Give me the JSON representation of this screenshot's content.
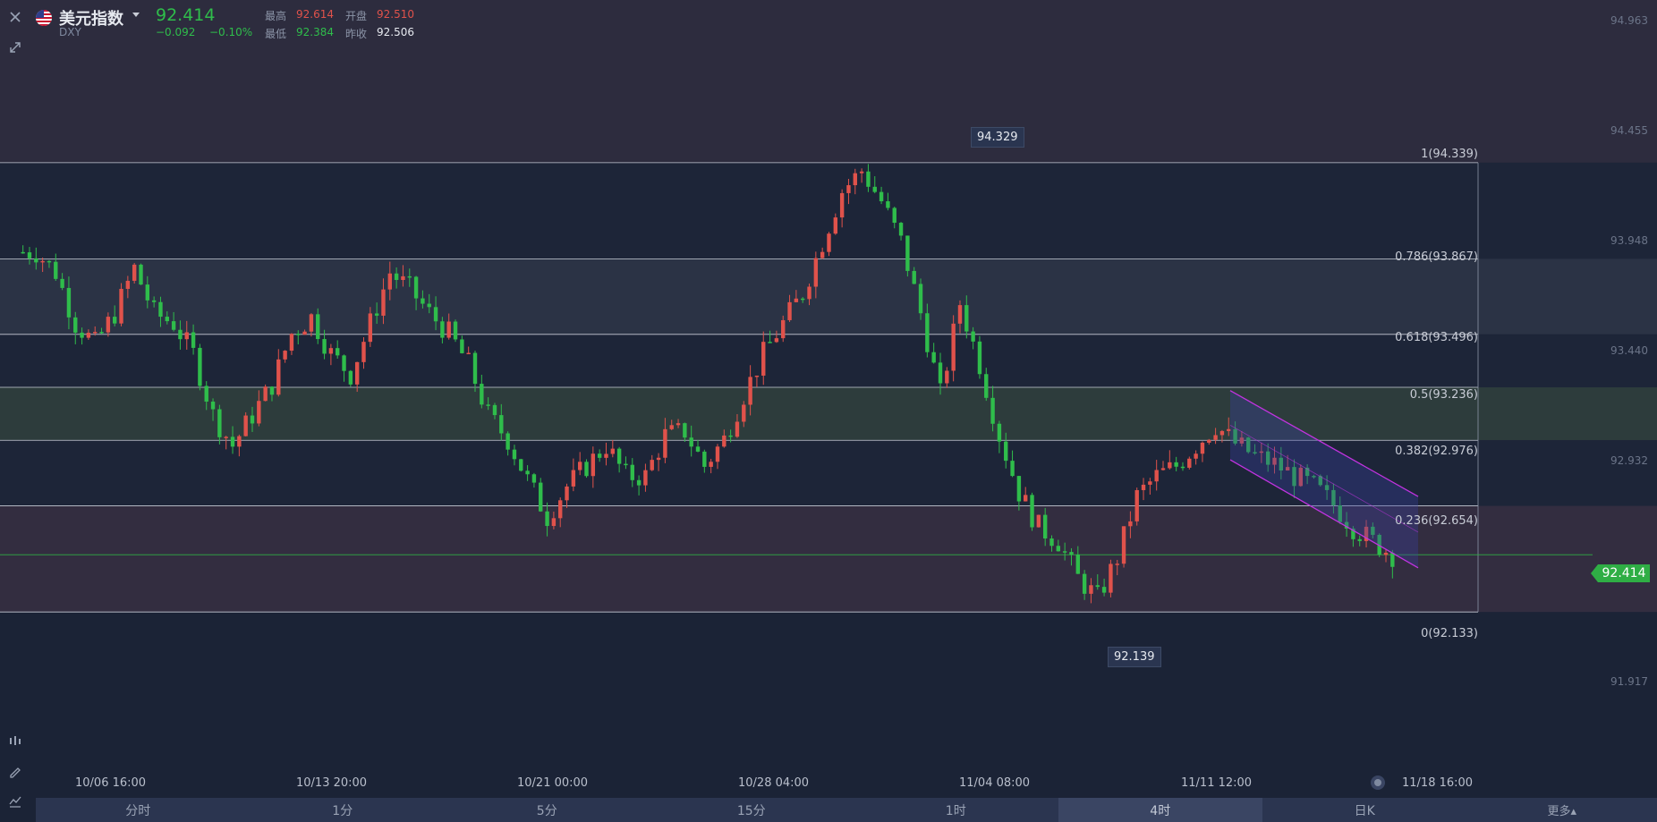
{
  "header": {
    "name": "美元指数",
    "ticker": "DXY",
    "price": "92.414",
    "change": "−0.092",
    "change_pct": "−0.10%",
    "high_label": "最高",
    "high": "92.614",
    "open_label": "开盘",
    "open": "92.510",
    "low_label": "最低",
    "low": "92.384",
    "prev_label": "昨收",
    "prev": "92.506"
  },
  "price_axis": [
    "94.963",
    "94.455",
    "93.948",
    "93.440",
    "92.932",
    "91.917"
  ],
  "current_price_tag": "92.414",
  "fib_levels": [
    {
      "label": "1(94.339)",
      "price": 94.339
    },
    {
      "label": "0.786(93.867)",
      "price": 93.867
    },
    {
      "label": "0.618(93.496)",
      "price": 93.496
    },
    {
      "label": "0.5(93.236)",
      "price": 93.236
    },
    {
      "label": "0.382(92.976)",
      "price": 92.976
    },
    {
      "label": "0.236(92.654)",
      "price": 92.654
    },
    {
      "label": "0(92.133)",
      "price": 92.133
    }
  ],
  "extremes": {
    "high_label": "94.329",
    "low_label": "92.139"
  },
  "time_axis": [
    "10/06 16:00",
    "10/13 20:00",
    "10/21 00:00",
    "10/28 04:00",
    "11/04 08:00",
    "11/11 12:00",
    "11/18 16:00"
  ],
  "timeframes": [
    {
      "label": "分时",
      "active": false
    },
    {
      "label": "1分",
      "active": false
    },
    {
      "label": "5分",
      "active": false
    },
    {
      "label": "15分",
      "active": false
    },
    {
      "label": "1时",
      "active": false
    },
    {
      "label": "4时",
      "active": true
    },
    {
      "label": "日K",
      "active": false
    }
  ],
  "more_label": "更多▴",
  "icons": [
    "close-icon",
    "expand-icon",
    "indicators-icon",
    "draw-icon",
    "chart-type-icon",
    "reset-icon"
  ],
  "colors": {
    "up": "#e0524b",
    "down": "#2fbd4b",
    "background": "#1c2438",
    "channel": "#c233e0"
  },
  "chart_data": {
    "type": "candlestick",
    "ylim": [
      91.8,
      95.05
    ],
    "series_close": [
      93.9,
      93.8,
      93.55,
      93.45,
      93.6,
      93.82,
      93.6,
      93.55,
      93.4,
      93.1,
      92.95,
      93.1,
      93.25,
      93.5,
      93.58,
      93.4,
      93.3,
      93.55,
      93.8,
      93.72,
      93.6,
      93.5,
      93.35,
      93.1,
      92.98,
      92.78,
      92.6,
      92.75,
      92.85,
      92.95,
      92.8,
      92.8,
      93.0,
      93.02,
      92.85,
      92.98,
      93.2,
      93.4,
      93.55,
      93.7,
      93.95,
      94.2,
      94.3,
      94.15,
      93.95,
      93.6,
      93.2,
      93.65,
      93.35,
      93.0,
      92.72,
      92.55,
      92.48,
      92.3,
      92.2,
      92.4,
      92.7,
      92.8,
      92.85,
      92.95,
      93.05,
      92.96,
      92.9,
      92.86,
      92.8,
      92.75,
      92.66,
      92.55,
      92.48,
      92.414
    ],
    "last": 92.414
  }
}
